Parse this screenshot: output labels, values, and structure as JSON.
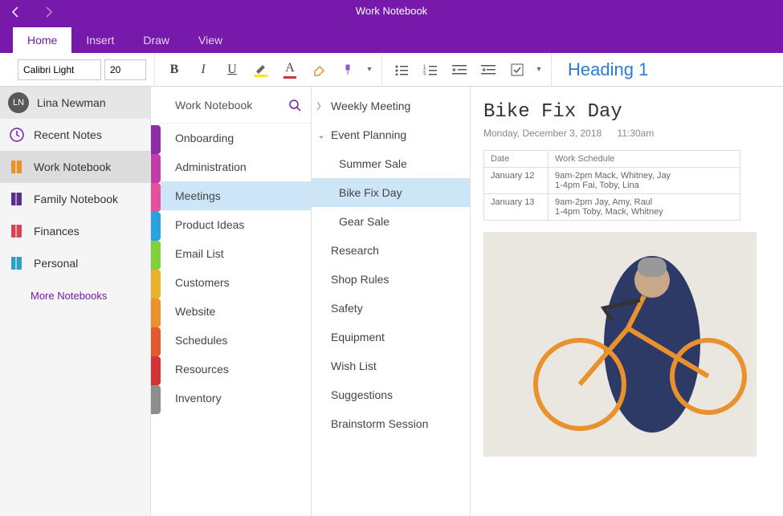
{
  "window": {
    "title": "Work Notebook"
  },
  "tabs": {
    "home": "Home",
    "insert": "Insert",
    "draw": "Draw",
    "view": "View"
  },
  "toolbar": {
    "font": "Calibri Light",
    "size": "20",
    "styleLabel": "Heading 1",
    "colors": {
      "highlight": "#FFE600",
      "fontcolor": "#D13438"
    }
  },
  "profile": {
    "name": "Lina Newman",
    "initials": "LN"
  },
  "notebooks": [
    {
      "label": "Recent Notes",
      "icon": "clock",
      "color": "#7719AA"
    },
    {
      "label": "Work Notebook",
      "icon": "book",
      "color": "#E8912D"
    },
    {
      "label": "Family Notebook",
      "icon": "book",
      "color": "#5B2D8E"
    },
    {
      "label": "Finances",
      "icon": "book",
      "color": "#D64554"
    },
    {
      "label": "Personal",
      "icon": "book",
      "color": "#2AA2C8"
    }
  ],
  "moreNotebooks": "More Notebooks",
  "sectionColors": [
    "#8E2DA8",
    "#C23DAA",
    "#E0529B",
    "#2AA2E0",
    "#7FD13B",
    "#E8B22D",
    "#E8912D",
    "#E05A2D",
    "#D13438",
    "#8E8E8E"
  ],
  "sectionsHeader": "Work Notebook",
  "sections": [
    "Onboarding",
    "Administration",
    "Meetings",
    "Product Ideas",
    "Email List",
    "Customers",
    "Website",
    "Schedules",
    "Resources",
    "Inventory"
  ],
  "selectedSection": 2,
  "pages": [
    {
      "label": "Weekly Meeting",
      "caret": "right",
      "indent": 0
    },
    {
      "label": "Event Planning",
      "caret": "down",
      "indent": 0
    },
    {
      "label": "Summer Sale",
      "caret": "",
      "indent": 1
    },
    {
      "label": "Bike Fix Day",
      "caret": "",
      "indent": 1,
      "selected": true
    },
    {
      "label": "Gear Sale",
      "caret": "",
      "indent": 1
    },
    {
      "label": "Research",
      "caret": "",
      "indent": 0
    },
    {
      "label": "Shop Rules",
      "caret": "",
      "indent": 0
    },
    {
      "label": "Safety",
      "caret": "",
      "indent": 0
    },
    {
      "label": "Equipment",
      "caret": "",
      "indent": 0
    },
    {
      "label": "Wish List",
      "caret": "",
      "indent": 0
    },
    {
      "label": "Suggestions",
      "caret": "",
      "indent": 0
    },
    {
      "label": "Brainstorm Session",
      "caret": "",
      "indent": 0
    }
  ],
  "page": {
    "title": "Bike Fix Day",
    "date": "Monday, December 3, 2018",
    "time": "11:30am",
    "table": {
      "headers": [
        "Date",
        "Work Schedule"
      ],
      "rows": [
        [
          "January 12",
          "9am-2pm Mack, Whitney, Jay\n1-4pm Fai, Toby, Lina"
        ],
        [
          "January 13",
          "9am-2pm Jay, Amy, Raul\n1-4pm Toby, Mack, Whitney"
        ]
      ]
    }
  }
}
